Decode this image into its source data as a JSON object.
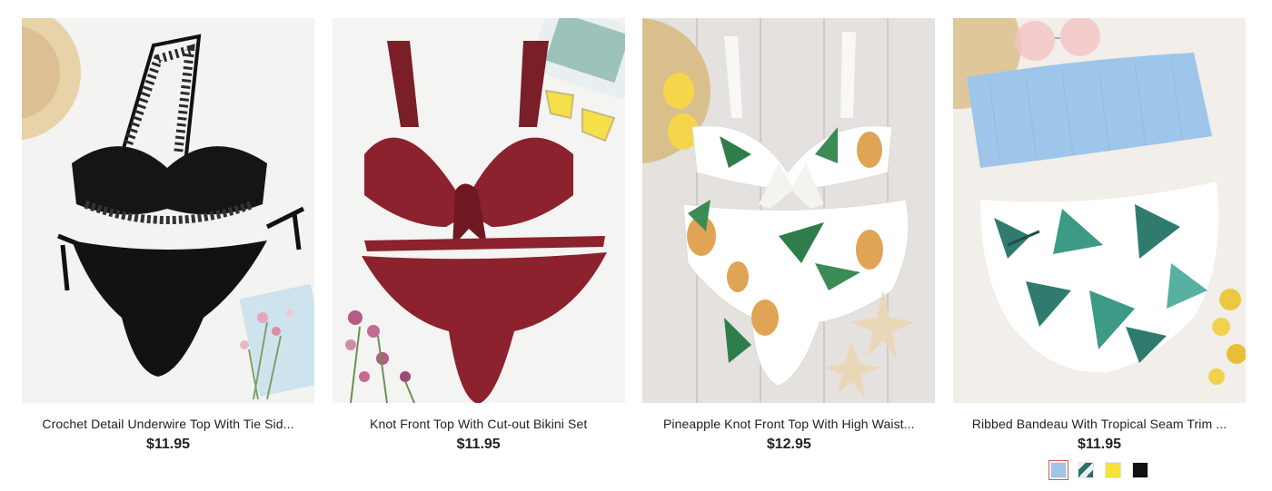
{
  "products": [
    {
      "title": "Crochet Detail Underwire Top With Tie Sid...",
      "price": "$11.95",
      "image": "black-crochet-bikini-photo"
    },
    {
      "title": "Knot Front Top With Cut-out Bikini Set",
      "price": "$11.95",
      "image": "burgundy-knot-bikini-photo"
    },
    {
      "title": "Pineapple Knot Front Top With High Waist...",
      "price": "$12.95",
      "image": "pineapple-print-bikini-photo"
    },
    {
      "title": "Ribbed Bandeau With Tropical Seam Trim ...",
      "price": "$11.95",
      "image": "blue-bandeau-tropical-bikini-photo",
      "swatches": [
        {
          "name": "light-blue",
          "color": "#9fc6e7",
          "selected": true
        },
        {
          "name": "tropical-print",
          "color": "#2f6d6a",
          "selected": false
        },
        {
          "name": "yellow",
          "color": "#f4e23a",
          "selected": false
        },
        {
          "name": "black",
          "color": "#111111",
          "selected": false
        }
      ]
    }
  ],
  "colors": {
    "text": "#222222",
    "selected_swatch_border": "#c9595d"
  }
}
